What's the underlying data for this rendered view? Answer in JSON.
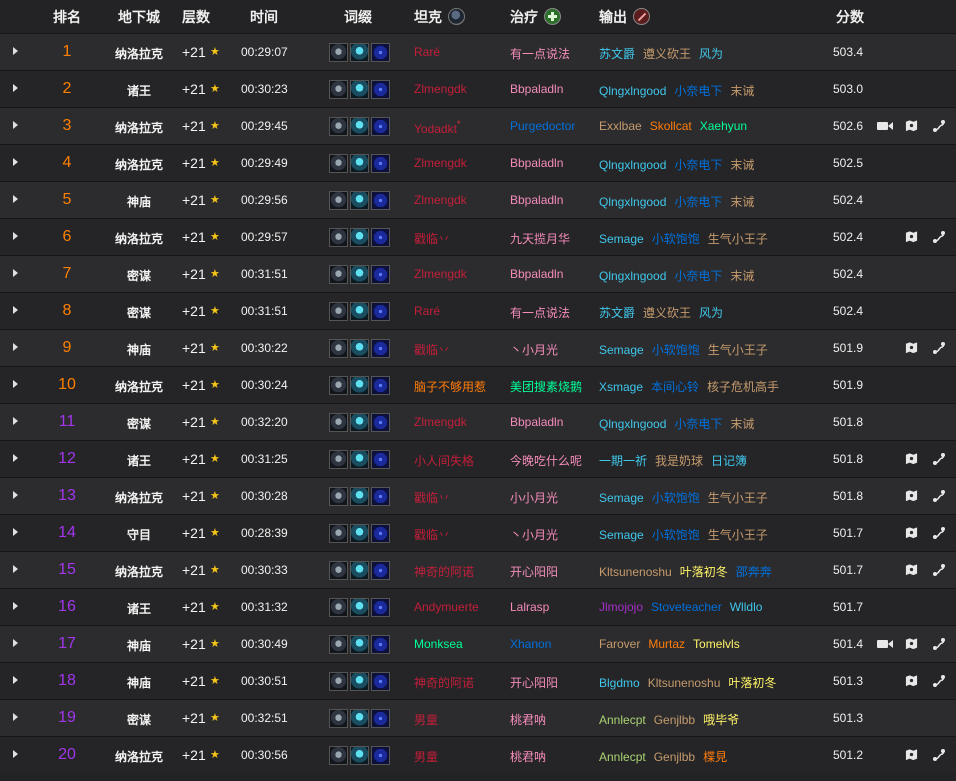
{
  "header": {
    "rank": "排名",
    "dungeon": "地下城",
    "level": "层数",
    "time": "时间",
    "affixes": "词缀",
    "tank": "坦克",
    "heal": "治疗",
    "dps": "输出",
    "score": "分数"
  },
  "icons": {
    "expand": "expand-arrow-icon",
    "star": "★",
    "video": "video-camera-icon",
    "camp": "map-icon",
    "route": "route-icon"
  },
  "colors": {
    "rank_orange": "#ff8000",
    "rank_purple": "#a335ee",
    "dk": "#c41e3a",
    "paladin": "#f48cba",
    "shaman": "#0070dd",
    "priest": "#ffffff",
    "mage": "#3fc7eb",
    "hunter": "#aad372",
    "rogue": "#fff468",
    "warrior": "#c69b6d",
    "monk": "#00ff98",
    "druid": "#ff7c0a",
    "warlock": "#8788ee",
    "dh": "#a330c9",
    "evoker": "#33937f"
  },
  "rows": [
    {
      "rank": "1",
      "dungeon": "纳洛拉克",
      "level": "+21",
      "time": "00:29:07",
      "tank": {
        "n": "Raré",
        "c": "#c41e3a"
      },
      "heal": {
        "n": "有一点说法",
        "c": "#f48cba"
      },
      "dps": [
        {
          "n": "苏文爵",
          "c": "#3fc7eb"
        },
        {
          "n": "遵义砍王",
          "c": "#c69b6d"
        },
        {
          "n": "风为",
          "c": "#3fc7eb"
        }
      ],
      "score": "503.4",
      "video": false,
      "camp": false,
      "route": false
    },
    {
      "rank": "2",
      "dungeon": "诸王",
      "level": "+21",
      "time": "00:30:23",
      "tank": {
        "n": "Zlmengdk",
        "c": "#c41e3a"
      },
      "heal": {
        "n": "Bbpaladln",
        "c": "#f48cba"
      },
      "dps": [
        {
          "n": "Qlngxlngood",
          "c": "#3fc7eb"
        },
        {
          "n": "小奈电下",
          "c": "#0070dd"
        },
        {
          "n": "末诫",
          "c": "#c69b6d"
        }
      ],
      "score": "503.0",
      "video": false,
      "camp": false,
      "route": false
    },
    {
      "rank": "3",
      "dungeon": "纳洛拉克",
      "level": "+21",
      "time": "00:29:45",
      "tank": {
        "n": "Yodadkt",
        "c": "#c41e3a",
        "sup": "*"
      },
      "heal": {
        "n": "Purgedoctor",
        "c": "#0070dd"
      },
      "dps": [
        {
          "n": "Exxlbae",
          "c": "#c69b6d"
        },
        {
          "n": "Skollcat",
          "c": "#ff7c0a"
        },
        {
          "n": "Xaehyun",
          "c": "#00ff98"
        }
      ],
      "score": "502.6",
      "video": true,
      "camp": true,
      "route": true
    },
    {
      "rank": "4",
      "dungeon": "纳洛拉克",
      "level": "+21",
      "time": "00:29:49",
      "tank": {
        "n": "Zlmengdk",
        "c": "#c41e3a"
      },
      "heal": {
        "n": "Bbpaladln",
        "c": "#f48cba"
      },
      "dps": [
        {
          "n": "Qlngxlngood",
          "c": "#3fc7eb"
        },
        {
          "n": "小奈电下",
          "c": "#0070dd"
        },
        {
          "n": "末诫",
          "c": "#c69b6d"
        }
      ],
      "score": "502.5",
      "video": false,
      "camp": false,
      "route": false
    },
    {
      "rank": "5",
      "dungeon": "神庙",
      "level": "+21",
      "time": "00:29:56",
      "tank": {
        "n": "Zlmengdk",
        "c": "#c41e3a"
      },
      "heal": {
        "n": "Bbpaladln",
        "c": "#f48cba"
      },
      "dps": [
        {
          "n": "Qlngxlngood",
          "c": "#3fc7eb"
        },
        {
          "n": "小奈电下",
          "c": "#0070dd"
        },
        {
          "n": "末诫",
          "c": "#c69b6d"
        }
      ],
      "score": "502.4",
      "video": false,
      "camp": false,
      "route": false
    },
    {
      "rank": "6",
      "dungeon": "纳洛拉克",
      "level": "+21",
      "time": "00:29:57",
      "tank": {
        "n": "戳临丷",
        "c": "#c41e3a"
      },
      "heal": {
        "n": "九天揽月华",
        "c": "#f48cba"
      },
      "dps": [
        {
          "n": "Semage",
          "c": "#3fc7eb"
        },
        {
          "n": "小软饱饱",
          "c": "#0070dd"
        },
        {
          "n": "生气小王子",
          "c": "#c69b6d"
        }
      ],
      "score": "502.4",
      "video": false,
      "camp": true,
      "route": true
    },
    {
      "rank": "7",
      "dungeon": "密谋",
      "level": "+21",
      "time": "00:31:51",
      "tank": {
        "n": "Zlmengdk",
        "c": "#c41e3a"
      },
      "heal": {
        "n": "Bbpaladln",
        "c": "#f48cba"
      },
      "dps": [
        {
          "n": "Qlngxlngood",
          "c": "#3fc7eb"
        },
        {
          "n": "小奈电下",
          "c": "#0070dd"
        },
        {
          "n": "末诫",
          "c": "#c69b6d"
        }
      ],
      "score": "502.4",
      "video": false,
      "camp": false,
      "route": false
    },
    {
      "rank": "8",
      "dungeon": "密谋",
      "level": "+21",
      "time": "00:31:51",
      "tank": {
        "n": "Raré",
        "c": "#c41e3a"
      },
      "heal": {
        "n": "有一点说法",
        "c": "#f48cba"
      },
      "dps": [
        {
          "n": "苏文爵",
          "c": "#3fc7eb"
        },
        {
          "n": "遵义砍王",
          "c": "#c69b6d"
        },
        {
          "n": "风为",
          "c": "#3fc7eb"
        }
      ],
      "score": "502.4",
      "video": false,
      "camp": false,
      "route": false
    },
    {
      "rank": "9",
      "dungeon": "神庙",
      "level": "+21",
      "time": "00:30:22",
      "tank": {
        "n": "戳临丷",
        "c": "#c41e3a"
      },
      "heal": {
        "n": "丶小月光",
        "c": "#f48cba"
      },
      "dps": [
        {
          "n": "Semage",
          "c": "#3fc7eb"
        },
        {
          "n": "小软饱饱",
          "c": "#0070dd"
        },
        {
          "n": "生气小王子",
          "c": "#c69b6d"
        }
      ],
      "score": "501.9",
      "video": false,
      "camp": true,
      "route": true
    },
    {
      "rank": "10",
      "dungeon": "纳洛拉克",
      "level": "+21",
      "time": "00:30:24",
      "tank": {
        "n": "脑子不够用惹",
        "c": "#ff7c0a"
      },
      "heal": {
        "n": "美团搜素烧鹅",
        "c": "#00ff98"
      },
      "dps": [
        {
          "n": "Xsmage",
          "c": "#3fc7eb"
        },
        {
          "n": "本间心铃",
          "c": "#0070dd"
        },
        {
          "n": "核子危机高手",
          "c": "#c69b6d"
        }
      ],
      "score": "501.9",
      "video": false,
      "camp": false,
      "route": false
    },
    {
      "rank": "11",
      "dungeon": "密谋",
      "level": "+21",
      "time": "00:32:20",
      "tank": {
        "n": "Zlmengdk",
        "c": "#c41e3a"
      },
      "heal": {
        "n": "Bbpaladln",
        "c": "#f48cba"
      },
      "dps": [
        {
          "n": "Qlngxlngood",
          "c": "#3fc7eb"
        },
        {
          "n": "小奈电下",
          "c": "#0070dd"
        },
        {
          "n": "末诫",
          "c": "#c69b6d"
        }
      ],
      "score": "501.8",
      "video": false,
      "camp": false,
      "route": false
    },
    {
      "rank": "12",
      "dungeon": "诸王",
      "level": "+21",
      "time": "00:31:25",
      "tank": {
        "n": "小人间失格",
        "c": "#c41e3a"
      },
      "heal": {
        "n": "今晚吃什么呢",
        "c": "#f48cba"
      },
      "dps": [
        {
          "n": "一期一祈",
          "c": "#3fc7eb"
        },
        {
          "n": "我是奶球",
          "c": "#c69b6d"
        },
        {
          "n": "日记簿",
          "c": "#3fc7eb"
        }
      ],
      "score": "501.8",
      "video": false,
      "camp": true,
      "route": true
    },
    {
      "rank": "13",
      "dungeon": "纳洛拉克",
      "level": "+21",
      "time": "00:30:28",
      "tank": {
        "n": "戳临丷",
        "c": "#c41e3a"
      },
      "heal": {
        "n": "小小月光",
        "c": "#f48cba"
      },
      "dps": [
        {
          "n": "Semage",
          "c": "#3fc7eb"
        },
        {
          "n": "小软饱饱",
          "c": "#0070dd"
        },
        {
          "n": "生气小王子",
          "c": "#c69b6d"
        }
      ],
      "score": "501.8",
      "video": false,
      "camp": true,
      "route": true
    },
    {
      "rank": "14",
      "dungeon": "守目",
      "level": "+21",
      "time": "00:28:39",
      "tank": {
        "n": "戳临丷",
        "c": "#c41e3a"
      },
      "heal": {
        "n": "丶小月光",
        "c": "#f48cba"
      },
      "dps": [
        {
          "n": "Semage",
          "c": "#3fc7eb"
        },
        {
          "n": "小软饱饱",
          "c": "#0070dd"
        },
        {
          "n": "生气小王子",
          "c": "#c69b6d"
        }
      ],
      "score": "501.7",
      "video": false,
      "camp": true,
      "route": true
    },
    {
      "rank": "15",
      "dungeon": "纳洛拉克",
      "level": "+21",
      "time": "00:30:33",
      "tank": {
        "n": "神奇的阿诺",
        "c": "#c41e3a"
      },
      "heal": {
        "n": "开心阳阳",
        "c": "#f48cba"
      },
      "dps": [
        {
          "n": "Kltsunenoshu",
          "c": "#c69b6d"
        },
        {
          "n": "叶落初冬",
          "c": "#fff468"
        },
        {
          "n": "邵奔奔",
          "c": "#0070dd"
        }
      ],
      "score": "501.7",
      "video": false,
      "camp": true,
      "route": true
    },
    {
      "rank": "16",
      "dungeon": "诸王",
      "level": "+21",
      "time": "00:31:32",
      "tank": {
        "n": "Andymuerte",
        "c": "#c41e3a"
      },
      "heal": {
        "n": "Lalrasp",
        "c": "#f48cba"
      },
      "dps": [
        {
          "n": "Jlmojojo",
          "c": "#a330c9"
        },
        {
          "n": "Stoveteacher",
          "c": "#0070dd"
        },
        {
          "n": "Wlldlo",
          "c": "#3fc7eb"
        }
      ],
      "score": "501.7",
      "video": false,
      "camp": false,
      "route": false
    },
    {
      "rank": "17",
      "dungeon": "神庙",
      "level": "+21",
      "time": "00:30:49",
      "tank": {
        "n": "Monksea",
        "c": "#00ff98"
      },
      "heal": {
        "n": "Xhanon",
        "c": "#0070dd"
      },
      "dps": [
        {
          "n": "Farover",
          "c": "#c69b6d"
        },
        {
          "n": "Murtaz",
          "c": "#ff7c0a"
        },
        {
          "n": "Tomelvls",
          "c": "#fff468"
        }
      ],
      "score": "501.4",
      "video": true,
      "camp": true,
      "route": true
    },
    {
      "rank": "18",
      "dungeon": "神庙",
      "level": "+21",
      "time": "00:30:51",
      "tank": {
        "n": "神奇的阿诺",
        "c": "#c41e3a"
      },
      "heal": {
        "n": "开心阳阳",
        "c": "#f48cba"
      },
      "dps": [
        {
          "n": "Blgdmo",
          "c": "#3fc7eb"
        },
        {
          "n": "Kltsunenoshu",
          "c": "#c69b6d"
        },
        {
          "n": "叶落初冬",
          "c": "#fff468"
        }
      ],
      "score": "501.3",
      "video": false,
      "camp": true,
      "route": true
    },
    {
      "rank": "19",
      "dungeon": "密谋",
      "level": "+21",
      "time": "00:32:51",
      "tank": {
        "n": "男童",
        "c": "#c41e3a"
      },
      "heal": {
        "n": "桃君呐",
        "c": "#f48cba"
      },
      "dps": [
        {
          "n": "Annlecpt",
          "c": "#aad372"
        },
        {
          "n": "Genjlbb",
          "c": "#c69b6d"
        },
        {
          "n": "哦毕爷",
          "c": "#fff468"
        }
      ],
      "score": "501.3",
      "video": false,
      "camp": false,
      "route": false
    },
    {
      "rank": "20",
      "dungeon": "纳洛拉克",
      "level": "+21",
      "time": "00:30:56",
      "tank": {
        "n": "男童",
        "c": "#c41e3a"
      },
      "heal": {
        "n": "桃君呐",
        "c": "#f48cba"
      },
      "dps": [
        {
          "n": "Annlecpt",
          "c": "#aad372"
        },
        {
          "n": "Genjlbb",
          "c": "#c69b6d"
        },
        {
          "n": "楪見",
          "c": "#ff7c0a"
        }
      ],
      "score": "501.2",
      "video": false,
      "camp": true,
      "route": true
    }
  ]
}
